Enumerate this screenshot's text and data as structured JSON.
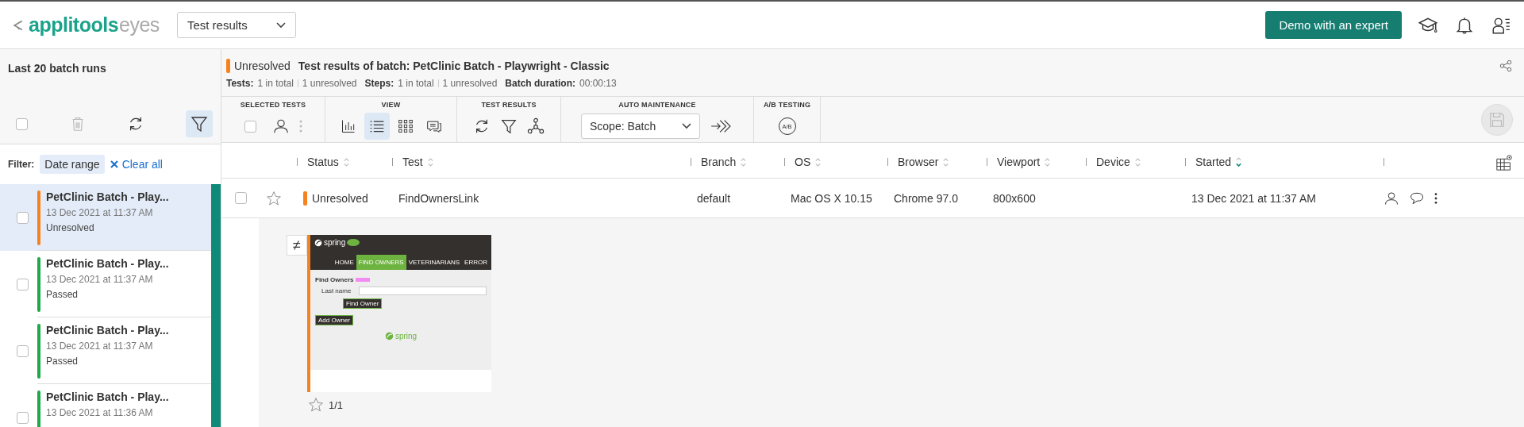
{
  "header": {
    "logo": {
      "brand": "applitools",
      "product": "eyes"
    },
    "view_select": "Test results",
    "demo_button": "Demo with an expert"
  },
  "sidebar": {
    "title": "Last 20 batch runs",
    "select_all_checked": false,
    "filter_active": true,
    "filter_label": "Filter:",
    "filter_chips": [
      "Date range"
    ],
    "clear_all": "Clear all",
    "items": [
      {
        "title": "PetClinic Batch - Play...",
        "date": "13 Dec 2021 at 11:37 AM",
        "status": "Unresolved",
        "color": "#f5821f",
        "selected": true,
        "checked": false
      },
      {
        "title": "PetClinic Batch - Play...",
        "date": "13 Dec 2021 at 11:37 AM",
        "status": "Passed",
        "color": "#1fa84a",
        "selected": false,
        "checked": false
      },
      {
        "title": "PetClinic Batch - Play...",
        "date": "13 Dec 2021 at 11:37 AM",
        "status": "Passed",
        "color": "#1fa84a",
        "selected": false,
        "checked": false
      },
      {
        "title": "PetClinic Batch - Play...",
        "date": "13 Dec 2021 at 11:36 AM",
        "color": "#1fa84a",
        "selected": false,
        "checked": false
      }
    ]
  },
  "batch": {
    "status": "Unresolved",
    "color": "#f5821f",
    "title": "Test results of batch: PetClinic Batch - Playwright - Classic",
    "stats": [
      {
        "label": "Tests:",
        "parts": [
          "1 in total",
          "1 unresolved"
        ]
      },
      {
        "label": "Steps:",
        "parts": [
          "1 in total",
          "1 unresolved"
        ]
      },
      {
        "label": "Batch duration:",
        "parts": [
          "00:00:13"
        ]
      }
    ]
  },
  "toolbar": {
    "selected_tests": {
      "title": "SELECTED TESTS",
      "checked": false
    },
    "view": {
      "title": "VIEW",
      "modes": [
        {
          "kind": "chart",
          "selected": false
        },
        {
          "kind": "list",
          "selected": true
        },
        {
          "kind": "grid",
          "selected": false
        },
        {
          "kind": "comments",
          "selected": false
        }
      ]
    },
    "test_results": {
      "title": "TEST RESULTS"
    },
    "auto_maintenance": {
      "title": "AUTO MAINTENANCE",
      "scope": "Scope: Batch"
    },
    "ab_testing": {
      "title": "A/B TESTING",
      "icon_label": "A/B"
    }
  },
  "table": {
    "columns": [
      {
        "label": "Status",
        "sorted": false
      },
      {
        "label": "Test",
        "sorted": false
      },
      {
        "label": "Branch",
        "sorted": false
      },
      {
        "label": "OS",
        "sorted": false
      },
      {
        "label": "Browser",
        "sorted": false
      },
      {
        "label": "Viewport",
        "sorted": false
      },
      {
        "label": "Device",
        "sorted": false
      },
      {
        "label": "Started",
        "sorted": true
      }
    ],
    "rows": [
      {
        "checked": false,
        "starred": false,
        "color": "#f5821f",
        "cells": [
          "Unresolved",
          "FindOwnersLink",
          "default",
          "Mac OS X 10.15",
          "Chrome 97.0",
          "800x600",
          "",
          "13 Dec 2021 at 11:37 AM"
        ]
      }
    ]
  },
  "steps": [
    {
      "diff_mark": "≠",
      "starred": false,
      "counter": "1/1",
      "color": "#f5821f",
      "thumbnail": {
        "brand": "spring",
        "nav": [
          {
            "label": "HOME",
            "selected": false
          },
          {
            "label": "FIND OWNERS",
            "selected": true
          },
          {
            "label": "VETERINARIANS",
            "selected": false
          },
          {
            "label": "ERROR",
            "selected": false
          }
        ],
        "heading": "Find Owners",
        "field_label": "Last name",
        "find_button": "Find Owner",
        "add_button": "Add Owner",
        "footer_brand": "spring"
      }
    }
  ]
}
